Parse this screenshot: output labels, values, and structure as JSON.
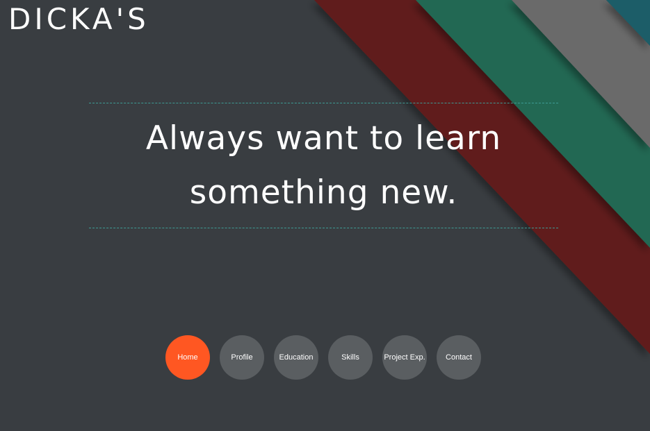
{
  "brand": {
    "title": "DICKA'S"
  },
  "hero": {
    "tagline": "Always want to learn something new."
  },
  "nav": {
    "items": [
      {
        "label": "Home",
        "active": true
      },
      {
        "label": "Profile",
        "active": false
      },
      {
        "label": "Education",
        "active": false
      },
      {
        "label": "Skills",
        "active": false
      },
      {
        "label": "Project Exp.",
        "active": false
      },
      {
        "label": "Contact",
        "active": false
      }
    ]
  },
  "colors": {
    "background": "#393d41",
    "accent": "#ff5722",
    "nav_inactive": "#5a5e61",
    "stripe_red": "#611d1b",
    "stripe_green": "#236852",
    "stripe_gray": "#6a6a6a",
    "stripe_teal": "#1f5d67",
    "divider": "#3d9c95"
  }
}
